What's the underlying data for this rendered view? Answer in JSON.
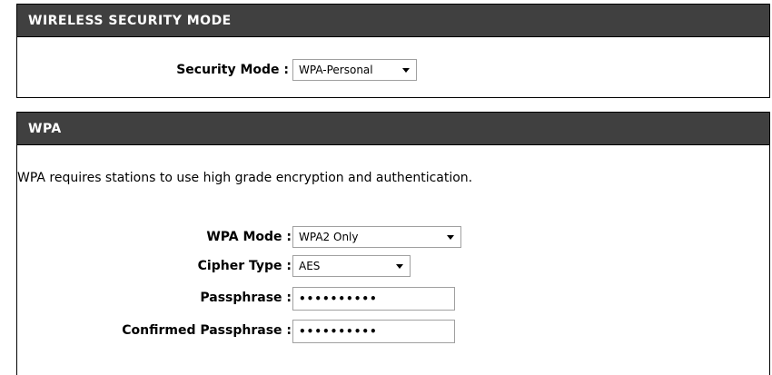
{
  "security_section": {
    "header": "WIRELESS SECURITY MODE",
    "security_mode_label": "Security Mode :",
    "security_mode_value": "WPA-Personal"
  },
  "wpa_section": {
    "header": "WPA",
    "description": "WPA requires stations to use high grade encryption and authentication.",
    "wpa_mode_label": "WPA Mode :",
    "wpa_mode_value": "WPA2 Only",
    "cipher_type_label": "Cipher Type :",
    "cipher_type_value": "AES",
    "passphrase_label": "Passphrase :",
    "passphrase_value": "••••••••••",
    "confirmed_passphrase_label": "Confirmed Passphrase :",
    "confirmed_passphrase_value": "••••••••••"
  },
  "icons": {
    "dropdown": "chevron-down-icon"
  }
}
